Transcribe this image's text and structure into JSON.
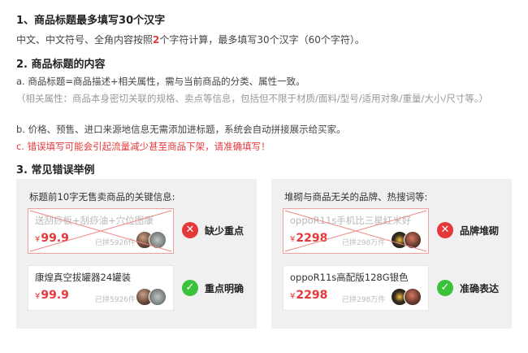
{
  "section1": {
    "heading": "1、商品标题最多填写30个汉字",
    "text_before": "中文、中文符号、全角内容按照",
    "text_highlight": "2",
    "text_after": "个字符计算，最多填写30个汉字（60个字符）。"
  },
  "section2": {
    "heading": "2.  商品标题的内容",
    "item_a": "a. 商品标题=商品描述+相关属性，需与当前商品的分类、属性一致。",
    "item_a_note": "（相关属性：商品本身密切关联的规格、卖点等信息，包括但不限于材质/面料/型号/适用对象/重量/大小/尺寸等。）",
    "item_b": "b. 价格、预售、进口来源地信息无需添加进标题，系统会自动拼接展示给买家。",
    "item_c": "c. 错误填写可能会引起流量减少甚至商品下架，请准确填写！"
  },
  "section3": {
    "heading": "3.  常见错误举例"
  },
  "examples": {
    "left": {
      "title": "标题前10字无售卖商品的关键信息:",
      "bad": {
        "product_title": "送刮痧板+刮痧油+穴位图康",
        "currency": "¥",
        "price": "99.9",
        "sold": "已拼5926件",
        "status": "缺少重点"
      },
      "good": {
        "product_title": "康煌真空拔罐器24罐装",
        "currency": "¥",
        "price": "99.9",
        "sold": "已拼5926件",
        "status": "重点明确"
      }
    },
    "right": {
      "title": "堆砌与商品无关的品牌、热搜词等:",
      "bad": {
        "product_title": "oppoR11s手机比三星红米好",
        "currency": "¥",
        "price": "2298",
        "sold": "已拼298万件",
        "status": "品牌堆砌"
      },
      "good": {
        "product_title": "oppoR11s高配版128G银色",
        "currency": "¥",
        "price": "2298",
        "sold": "已拼298万件",
        "status": "准确表达"
      }
    }
  },
  "icons": {
    "bad": "x-circle-icon",
    "good": "check-circle-icon"
  },
  "colors": {
    "accent_red": "#e5383b",
    "ok_green": "#3cc13b",
    "panel_bg": "#f0f0f0"
  }
}
